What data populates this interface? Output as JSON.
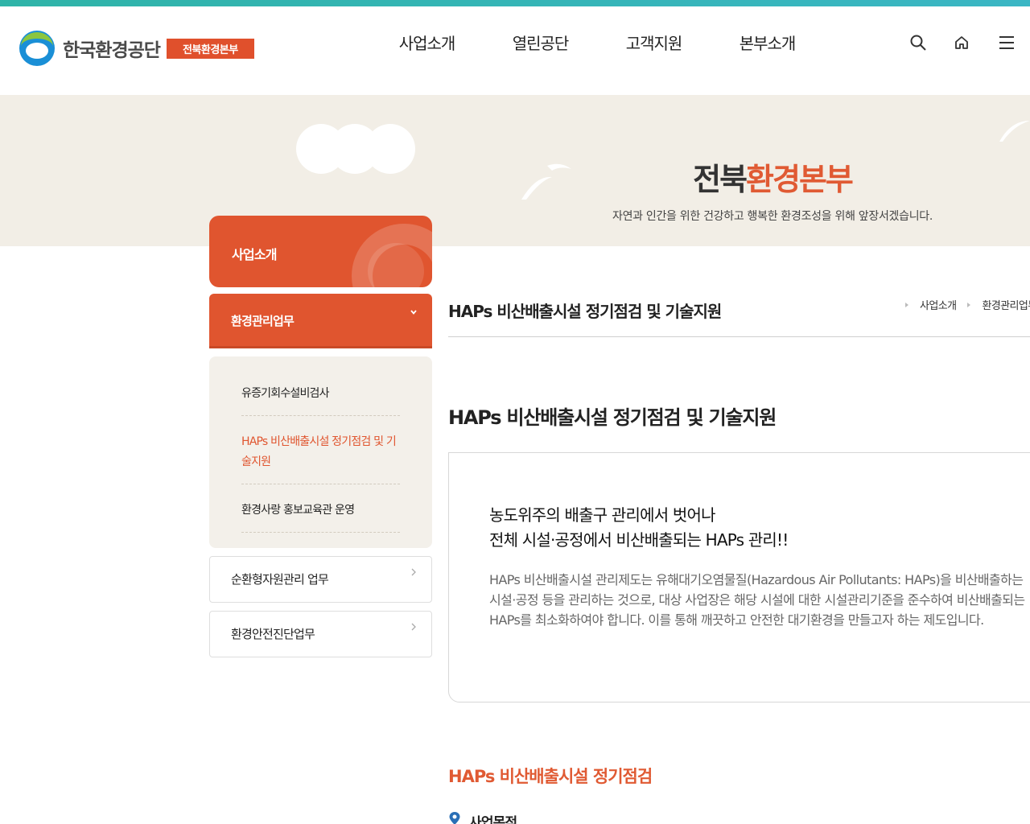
{
  "header": {
    "logo_text": "한국환경공단",
    "logo_badge": "전북환경본부",
    "nav": [
      "사업소개",
      "열린공단",
      "고객지원",
      "본부소개"
    ],
    "utilities": [
      "search-icon",
      "home-icon",
      "menu-icon"
    ]
  },
  "visual": {
    "title_plain": "전북",
    "title_accent": "환경본부",
    "subtitle": "자연과 인간을 위한 건강하고 행복한 환경조성을 위해 앞장서겠습니다."
  },
  "lnb": {
    "head": "사업소개",
    "group": "환경관리업무",
    "sub_items": [
      {
        "label": "유증기회수설비검사",
        "active": false
      },
      {
        "label": "HAPs 비산배출시설 정기점검 및 기술지원",
        "active": true
      },
      {
        "label": "환경사랑 홍보교육관 운영",
        "active": false
      }
    ],
    "boxes": [
      "순환형자원관리 업무",
      "환경안전진단업무"
    ]
  },
  "content": {
    "page_title": "HAPs 비산배출시설 정기점검 및 기술지원",
    "breadcrumb": [
      "사업소개",
      "환경관리업무"
    ],
    "section_heading": "HAPs 비산배출시설 정기점검 및 기술지원",
    "intro_lead_1": "농도위주의 배출구 관리에서 벗어나",
    "intro_lead_2": "전체 시설·공정에서 비산배출되는 HAPs 관리!!",
    "intro_body": "HAPs 비산배출시설 관리제도는 유해대기오염물질(Hazardous Air Pollutants: HAPs)을 비산배출하는 시설·공정 등을 관리하는 것으로, 대상 사업장은 해당 시설에 대한 시설관리기준을 준수하여 비산배출되는 HAPs를 최소화하여야 합니다. 이를 통해 깨끗하고 안전한 대기환경을 만들고자 하는 제도입니다.",
    "sub_heading": "HAPs 비산배출시설 정기점검",
    "sub_item": "사업목적"
  },
  "colors": {
    "accent": "#e0552f",
    "top_bar": "#2fb4a8",
    "visual_bg": "#f2eee6"
  }
}
